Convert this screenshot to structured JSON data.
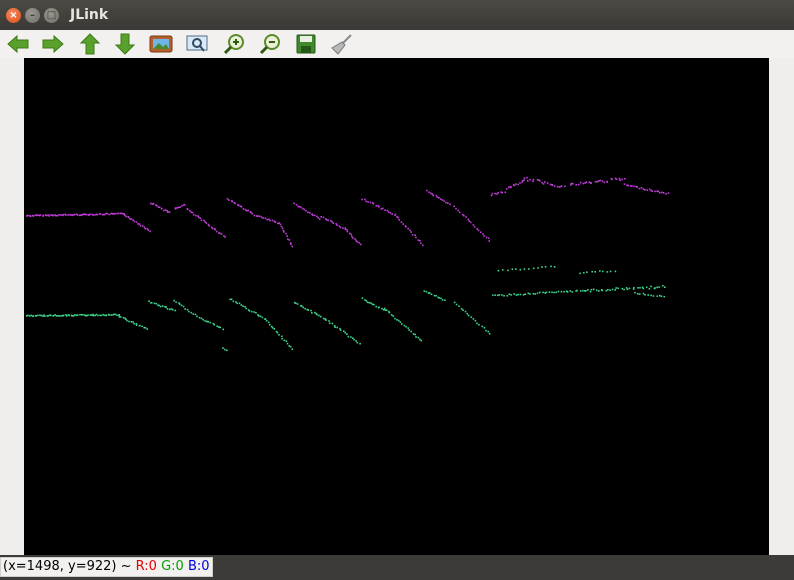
{
  "window": {
    "title": "JLink"
  },
  "toolbar": {
    "items": [
      {
        "icon": "arrow-left-icon"
      },
      {
        "icon": "arrow-right-icon"
      },
      {
        "icon": "arrow-up-icon"
      },
      {
        "icon": "arrow-down-icon"
      },
      {
        "icon": "image-icon"
      },
      {
        "icon": "zoom-fit-icon"
      },
      {
        "icon": "zoom-in-icon"
      },
      {
        "icon": "zoom-out-icon"
      },
      {
        "icon": "save-icon"
      },
      {
        "icon": "broom-icon"
      }
    ]
  },
  "status": {
    "coords": "(x=1498, y=922) ~",
    "r": "R:0",
    "g": "G:0",
    "b": "B:0"
  },
  "colors": {
    "magenta_points": "#c43cdc",
    "green_points": "#3cd68c",
    "canvas_bg": "#000000"
  }
}
